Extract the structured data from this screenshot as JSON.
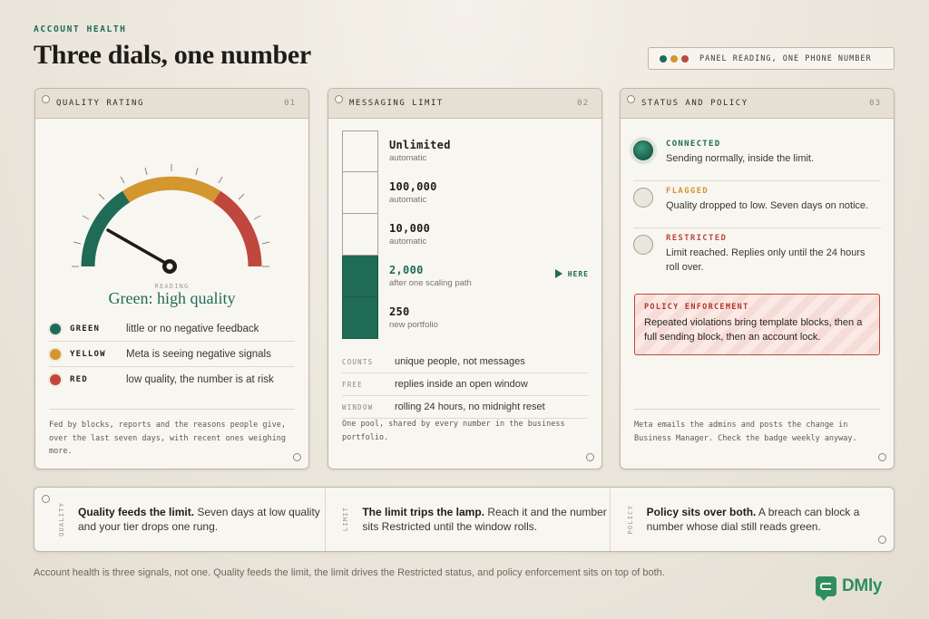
{
  "header": {
    "eyebrow": "ACCOUNT HEALTH",
    "title": "Three dials, one number",
    "legend_label": "PANEL READING, ONE PHONE NUMBER",
    "legend_colors": [
      "#1f6b56",
      "#d4962f",
      "#c0473d"
    ]
  },
  "colors": {
    "green": "#1f6b56",
    "yellow": "#d4962f",
    "red": "#c0473d"
  },
  "quality": {
    "title": "QUALITY RATING",
    "num": "01",
    "gauge": {
      "needle_value": "low-left green zone",
      "zones": [
        "green",
        "yellow",
        "red"
      ]
    },
    "reading_caption": "READING",
    "reading": "Green: high quality",
    "levels": [
      {
        "name": "GREEN",
        "desc": "little or no negative feedback",
        "color": "#1f6b56"
      },
      {
        "name": "YELLOW",
        "desc": "Meta is seeing negative signals",
        "color": "#d4962f"
      },
      {
        "name": "RED",
        "desc": "low quality, the number is at risk",
        "color": "#c0473d"
      }
    ],
    "footer": "Fed by blocks, reports and the reasons people give, over the last seven days, with recent ones weighing more."
  },
  "limit": {
    "title": "MESSAGING LIMIT",
    "num": "02",
    "tiers": [
      {
        "name": "Unlimited",
        "sub": "automatic",
        "filled": false,
        "active": false
      },
      {
        "name": "100,000",
        "sub": "automatic",
        "filled": false,
        "active": false
      },
      {
        "name": "10,000",
        "sub": "automatic",
        "filled": false,
        "active": false
      },
      {
        "name": "2,000",
        "sub": "after one scaling path",
        "filled": true,
        "active": true
      },
      {
        "name": "250",
        "sub": "new portfolio",
        "filled": true,
        "active": false
      }
    ],
    "here_label": "HERE",
    "facts": [
      {
        "k": "COUNTS",
        "v": "unique people, not messages"
      },
      {
        "k": "FREE",
        "v": "replies inside an open window"
      },
      {
        "k": "WINDOW",
        "v": "rolling 24 hours, no midnight reset"
      }
    ],
    "footer": "One pool, shared by every number in the business portfolio."
  },
  "status": {
    "title": "STATUS AND POLICY",
    "num": "03",
    "items": [
      {
        "name": "CONNECTED",
        "desc": "Sending normally, inside the limit.",
        "on": true,
        "color": "#1f6b56"
      },
      {
        "name": "FLAGGED",
        "desc": "Quality dropped to low. Seven days on notice.",
        "on": false,
        "color": "#d4962f"
      },
      {
        "name": "RESTRICTED",
        "desc": "Limit reached. Replies only until the 24 hours roll over.",
        "on": false,
        "color": "#c0473d"
      }
    ],
    "enforcement_title": "POLICY ENFORCEMENT",
    "enforcement_body": "Repeated violations bring template blocks, then a full sending block, then an account lock.",
    "footer": "Meta emails the admins and posts the change in Business Manager. Check the badge weekly anyway."
  },
  "strip": [
    {
      "tag": "QUALITY",
      "bold": "Quality feeds the limit.",
      "rest": " Seven days at low quality and your tier drops one rung."
    },
    {
      "tag": "LIMIT",
      "bold": "The limit trips the lamp.",
      "rest": " Reach it and the number sits Restricted until the window rolls."
    },
    {
      "tag": "POLICY",
      "bold": "Policy sits over both.",
      "rest": " A breach can block a number whose dial still reads green."
    }
  ],
  "caption": "Account health is three signals, not one. Quality feeds the limit, the limit drives the Restricted status, and policy enforcement sits on top of both.",
  "brand": "DMly"
}
